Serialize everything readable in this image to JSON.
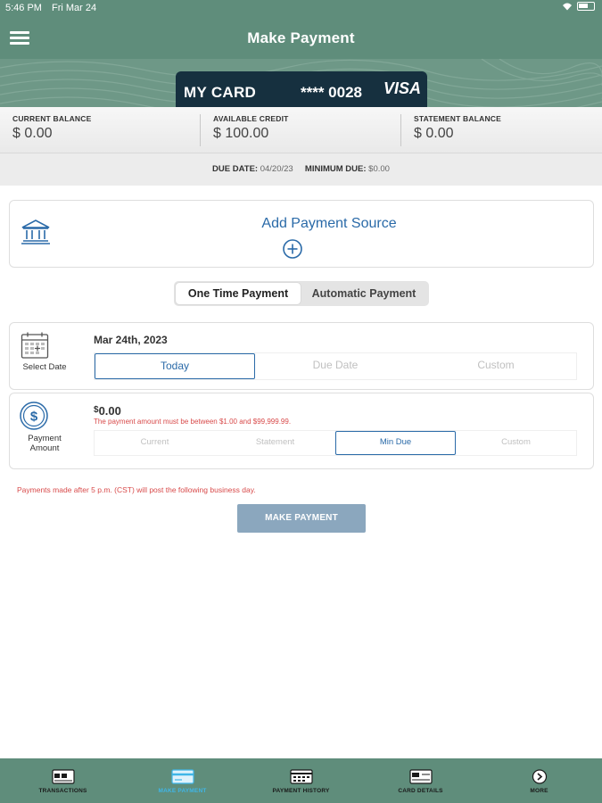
{
  "status_bar": {
    "time": "5:46 PM",
    "date": "Fri Mar 24"
  },
  "header": {
    "title": "Make Payment",
    "menu_icon": "hamburger-menu-icon"
  },
  "card": {
    "name": "MY CARD",
    "number": "**** 0028",
    "brand": "VISA"
  },
  "balances": [
    {
      "label": "CURRENT BALANCE",
      "value": "$ 0.00"
    },
    {
      "label": "AVAILABLE CREDIT",
      "value": "$ 100.00"
    },
    {
      "label": "STATEMENT BALANCE",
      "value": "$ 0.00"
    }
  ],
  "due": {
    "date_label": "DUE DATE:",
    "date_value": "04/20/23",
    "min_label": "MINIMUM DUE:",
    "min_value": "$0.00"
  },
  "payment_source": {
    "label": "Add Payment Source",
    "icon": "bank-icon",
    "action_icon": "plus-circle-icon"
  },
  "payment_type": {
    "options": [
      "One Time Payment",
      "Automatic Payment"
    ],
    "selected": "One Time Payment"
  },
  "select_date": {
    "label": "Select Date",
    "value": "Mar 24th, 2023",
    "options": [
      "Today",
      "Due Date",
      "Custom"
    ],
    "selected": "Today"
  },
  "payment_amount": {
    "label_line1": "Payment",
    "label_line2": "Amount",
    "currency": "$",
    "value": "0.00",
    "error": "The payment amount must be between $1.00 and $99,999.99.",
    "options": [
      "Current",
      "Statement",
      "Min Due",
      "Custom"
    ],
    "selected": "Min Due"
  },
  "cutoff_note": "Payments made after 5 p.m. (CST) will post the following business day.",
  "submit_label": "MAKE PAYMENT",
  "bottom_nav": [
    {
      "label": "TRANSACTIONS",
      "icon": "transactions-icon"
    },
    {
      "label": "MAKE PAYMENT",
      "icon": "make-payment-icon",
      "active": true
    },
    {
      "label": "PAYMENT HISTORY",
      "icon": "payment-history-icon"
    },
    {
      "label": "CARD DETAILS",
      "icon": "card-details-icon"
    },
    {
      "label": "MORE",
      "icon": "more-icon"
    }
  ],
  "colors": {
    "header": "#5f8d7b",
    "accent": "#2a6aa8",
    "error": "#d84a4a",
    "submit": "#8ba7be",
    "nav_active": "#3fb6e8"
  }
}
